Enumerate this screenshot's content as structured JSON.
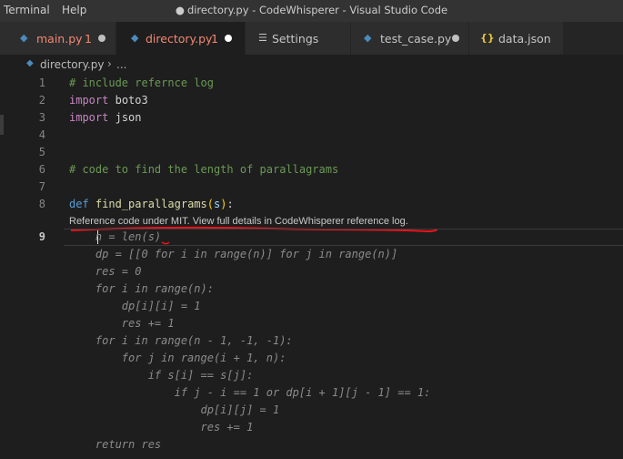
{
  "menu": {
    "terminal": "Terminal",
    "help": "Help"
  },
  "window_title": "directory.py - CodeWhisperer - Visual Studio Code",
  "window_title_dot": "●",
  "tabs": [
    {
      "label": "main.py",
      "problems": "1",
      "modified_dot": "●",
      "label_color": "#f48771",
      "icon": "python-icon"
    },
    {
      "label": "directory.py",
      "problems": "1",
      "modified_dot": "●",
      "label_color": "#f48771",
      "icon": "python-icon"
    },
    {
      "label": "Settings",
      "icon": "settings-icon",
      "icon_glyph": "☰"
    },
    {
      "label": "test_case.py",
      "modified_dot": "●",
      "icon": "python-icon"
    },
    {
      "label": "data.json",
      "icon": "json-icon",
      "icon_glyph": "{}"
    }
  ],
  "breadcrumb": {
    "file": "directory.py",
    "separator": "›",
    "rest": "..."
  },
  "line_numbers": [
    "1",
    "2",
    "3",
    "4",
    "5",
    "6",
    "7",
    "8",
    "9"
  ],
  "code": {
    "l1": "# include refernce log",
    "l2_kw": "import",
    "l2_mod": "boto3",
    "l3_kw": "import",
    "l3_mod": "json",
    "l6": "# code to find the length of parallagrams",
    "l8_def": "def",
    "l8_name": "find_parallagrams",
    "l8_open": "(",
    "l8_param": "s",
    "l8_close": ")",
    "l8_colon": ":"
  },
  "reference_note": "Reference code under MIT. View full details in CodeWhisperer reference log.",
  "suggestion_lines": [
    "    n = len(s)",
    "    dp = [[0 for i in range(n)] for j in range(n)]",
    "    res = 0",
    "    for i in range(n):",
    "        dp[i][i] = 1",
    "        res += 1",
    "    for i in range(n - 1, -1, -1):",
    "        for j in range(i + 1, n):",
    "            if s[i] == s[j]:",
    "                if j - i == 1 or dp[i + 1][j - 1] == 1:",
    "                    dp[i][j] = 1",
    "                    res += 1",
    "",
    "    return res"
  ],
  "colors": {
    "annotation_red": "#e8141c",
    "accent": "#569cd6",
    "error": "#f48771"
  }
}
